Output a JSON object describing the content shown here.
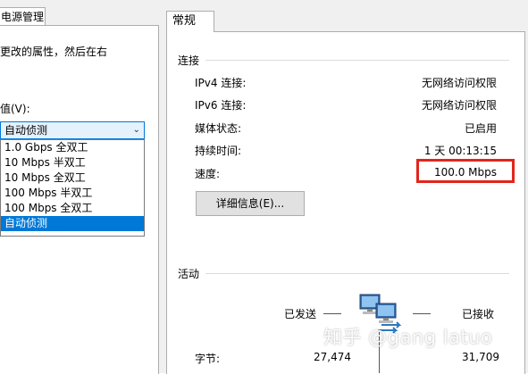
{
  "left_dialog": {
    "tab_label": "电源管理",
    "description": "更改的属性，然后在右",
    "value_label": "值(V):",
    "select_value": "自动侦测",
    "options": [
      "1.0 Gbps 全双工",
      "10 Mbps 半双工",
      "10 Mbps 全双工",
      "100 Mbps 半双工",
      "100 Mbps 全双工",
      "自动侦测"
    ],
    "selected_index": 5
  },
  "status_dialog": {
    "tab_label": "常规",
    "connection": {
      "title": "连接",
      "rows": [
        {
          "label": "IPv4 连接:",
          "value": "无网络访问权限"
        },
        {
          "label": "IPv6 连接:",
          "value": "无网络访问权限"
        },
        {
          "label": "媒体状态:",
          "value": "已启用"
        },
        {
          "label": "持续时间:",
          "value": "1 天 00:13:15"
        },
        {
          "label": "速度:",
          "value": "100.0 Mbps"
        }
      ],
      "details_button": "详细信息(E)..."
    },
    "activity": {
      "title": "活动",
      "sent_label": "已发送",
      "received_label": "已接收",
      "bytes_label": "字节:",
      "bytes_sent": "27,474",
      "bytes_received": "31,709"
    }
  },
  "watermark": "知乎 @gang latuo",
  "colors": {
    "highlight": "#e1261c",
    "selection": "#0078d7"
  }
}
